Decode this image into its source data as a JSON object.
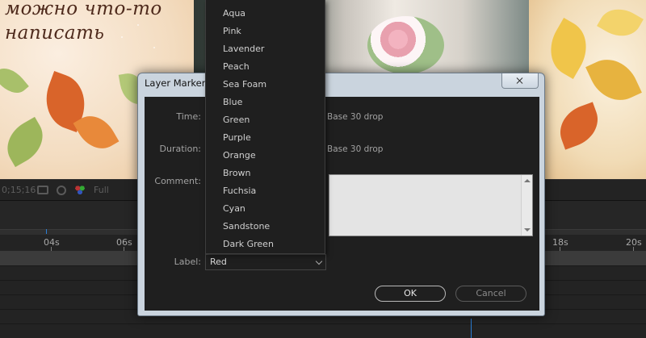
{
  "viewer": {
    "script_line1": "можно что-то",
    "script_line2": "написать",
    "toolbar": {
      "timecode": "0;15;16",
      "resolution": "Full"
    }
  },
  "timeline": {
    "ruler_ticks": [
      "04s",
      "06s",
      "18s",
      "20s"
    ]
  },
  "dialog": {
    "title": "Layer Marker",
    "time_label": "Time:",
    "time_suffix": "Base 30  drop",
    "duration_label": "Duration:",
    "duration_suffix": "Base 30  drop",
    "comment_label": "Comment:",
    "comment_value": "",
    "label_label": "Label:",
    "label_value": "Red",
    "ok_label": "OK",
    "cancel_label": "Cancel"
  },
  "label_dropdown": {
    "options": [
      "Aqua",
      "Pink",
      "Lavender",
      "Peach",
      "Sea Foam",
      "Blue",
      "Green",
      "Purple",
      "Orange",
      "Brown",
      "Fuchsia",
      "Cyan",
      "Sandstone",
      "Dark Green"
    ]
  },
  "colors": {
    "app_bg": "#1e1e1e",
    "dialog_frame": "#cad4de",
    "cti_blue": "#2b7fd7"
  }
}
